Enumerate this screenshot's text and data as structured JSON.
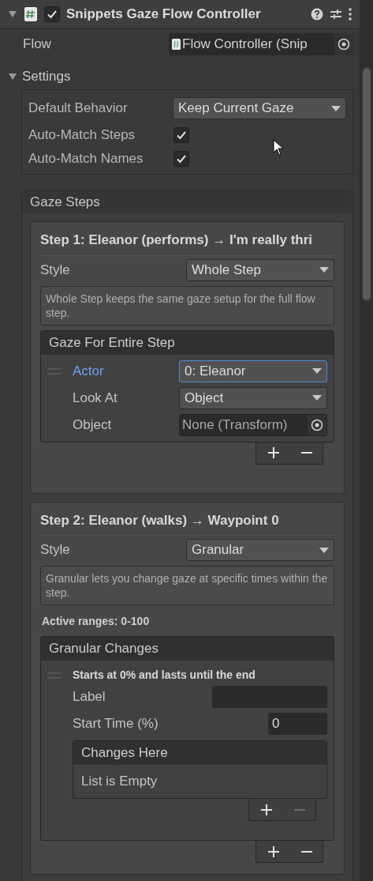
{
  "component": {
    "title": "Snippets Gaze Flow Controller",
    "enabled": true,
    "expanded": true
  },
  "flow": {
    "label": "Flow",
    "value": "Flow Controller (Snip"
  },
  "settings": {
    "title": "Settings",
    "expanded": true,
    "default_behavior": {
      "label": "Default Behavior",
      "value": "Keep Current Gaze"
    },
    "toggles": [
      {
        "label": "Auto-Match Steps",
        "checked": true
      },
      {
        "label": "Auto-Match Names",
        "checked": true
      }
    ]
  },
  "gaze_steps": {
    "title": "Gaze Steps",
    "steps": [
      {
        "kind": "whole",
        "title": "Step 1: Eleanor (performs) → I'm really thri",
        "style_label": "Style",
        "style_value": "Whole Step",
        "help": "Whole Step keeps the same gaze setup for the full flow step.",
        "list": {
          "title": "Gaze For Entire Step",
          "remove_disabled": false,
          "fields": [
            {
              "kind": "dropdown",
              "label": "Actor",
              "value": "0: Eleanor",
              "focused": true
            },
            {
              "kind": "dropdown",
              "label": "Look At",
              "value": "Object",
              "focused": false
            },
            {
              "kind": "object",
              "label": "Object",
              "value": "None (Transform)",
              "focused": false
            }
          ]
        }
      },
      {
        "kind": "granular",
        "title": "Step 2: Eleanor (walks) → Waypoint 0",
        "style_label": "Style",
        "style_value": "Granular",
        "help": "Granular lets you change gaze at specific times within the step.",
        "active_ranges": "Active ranges: 0-100",
        "list": {
          "title": "Granular Changes",
          "remove_disabled": false,
          "entry": {
            "title": "Starts at 0% and lasts until the end",
            "fields": [
              {
                "kind": "text",
                "label": "Label"
              },
              {
                "kind": "number",
                "label": "Start Time (%)",
                "value": "0"
              }
            ],
            "sublist": {
              "title": "Changes Here",
              "empty_text": "List is Empty",
              "remove_disabled": true
            }
          }
        }
      }
    ]
  }
}
